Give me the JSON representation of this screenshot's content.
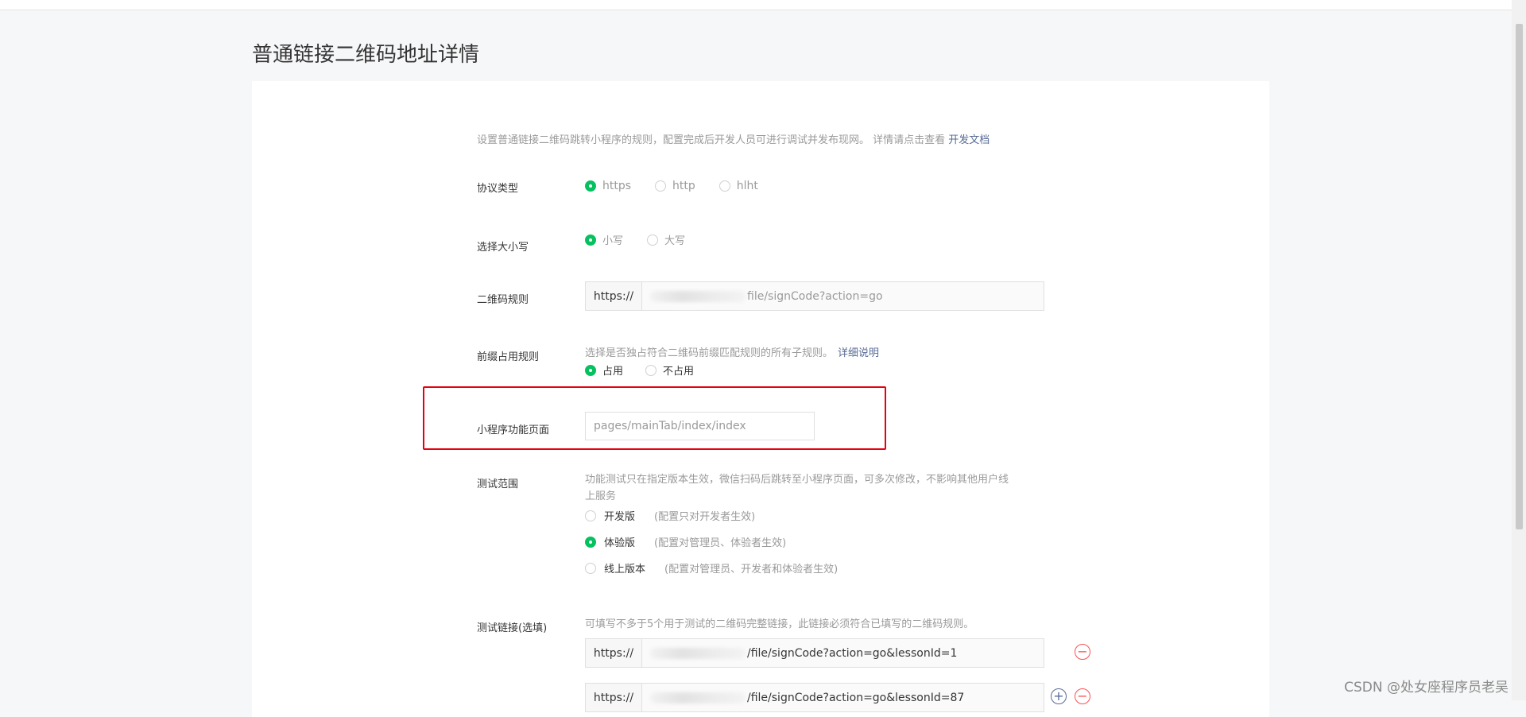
{
  "page": {
    "title": "普通链接二维码地址详情"
  },
  "intro": {
    "text": "设置普通链接二维码跳转小程序的规则，配置完成后开发人员可进行调试并发布现网。 详情请点击查看 ",
    "link": "开发文档"
  },
  "protocol": {
    "label": "协议类型",
    "options": [
      "https",
      "http",
      "hlht"
    ],
    "selected": "https"
  },
  "case": {
    "label": "选择大小写",
    "options": [
      "小写",
      "大写"
    ],
    "selected": "小写"
  },
  "qr_rule": {
    "label": "二维码规则",
    "prefix": "https://",
    "value": "file/signCode?action=go"
  },
  "prefix_rule": {
    "label": "前缀占用规则",
    "hint": "选择是否独占符合二维码前缀匹配规则的所有子规则。",
    "link": "详细说明",
    "options": [
      "占用",
      "不占用"
    ],
    "selected": "占用"
  },
  "mini_page": {
    "label": "小程序功能页面",
    "value": "pages/mainTab/index/index"
  },
  "test_scope": {
    "label": "测试范围",
    "hint_line1": "功能测试只在指定版本生效，微信扫码后跳转至小程序页面，可多次修改，不影响其他用户线",
    "hint_line2": "上服务",
    "options": [
      {
        "name": "开发版",
        "note": "(配置只对开发者生效)"
      },
      {
        "name": "体验版",
        "note": "(配置对管理员、体验者生效)"
      },
      {
        "name": "线上版本",
        "note": "(配置对管理员、开发者和体验者生效)"
      }
    ],
    "selected": "体验版"
  },
  "test_links": {
    "label": "测试链接(选填)",
    "hint": "可填写不多于5个用于测试的二维码完整链接，此链接必须符合已填写的二维码规则。",
    "prefix": "https://",
    "links": [
      "/file/signCode?action=go&lessonId=1",
      "/file/signCode?action=go&lessonId=87"
    ],
    "icons": {
      "remove": "minus-circle-icon",
      "add": "plus-circle-icon"
    }
  },
  "watermark": "CSDN @处女座程序员老吴",
  "colors": {
    "accent": "#07c160",
    "link": "#576b95",
    "highlight": "#e60012",
    "danger": "#fa5151"
  }
}
